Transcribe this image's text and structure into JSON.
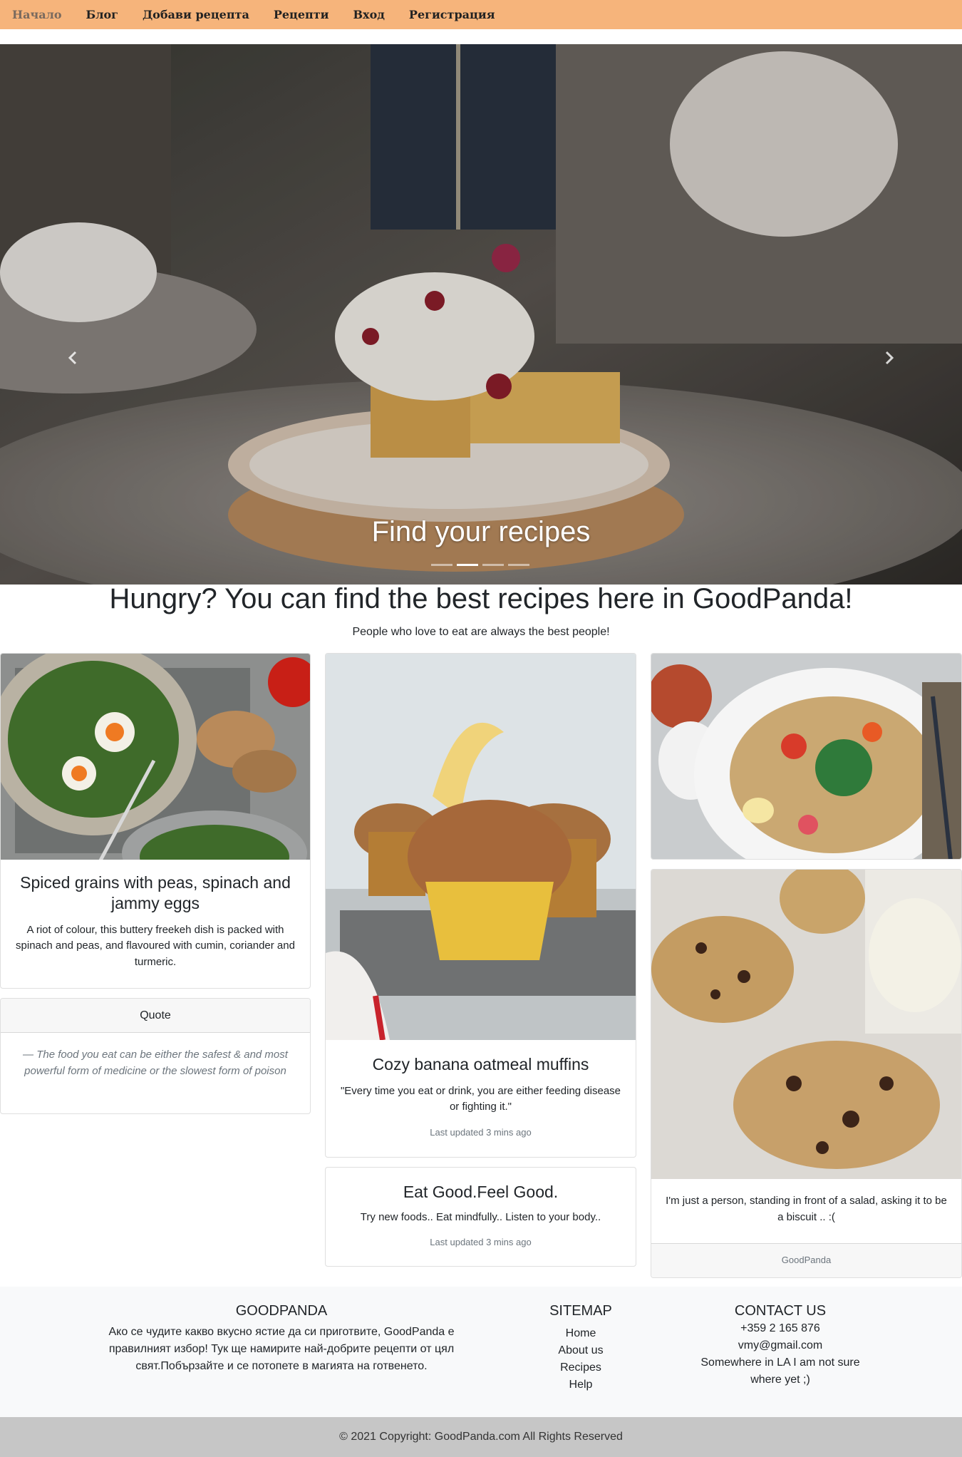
{
  "nav": {
    "items": [
      {
        "label": "Начало",
        "active": true
      },
      {
        "label": "Блог"
      },
      {
        "label": "Добави рецепта"
      },
      {
        "label": "Рецепти"
      },
      {
        "label": "Вход"
      },
      {
        "label": "Регистрация"
      }
    ]
  },
  "hero": {
    "caption": "Find your recipes",
    "active_slide": 2,
    "slide_count": 4
  },
  "intro": {
    "title": "Hungry? You can find the best recipes here in GoodPanda!",
    "subtitle": "People who love to eat are always the best people!"
  },
  "cards": {
    "grains": {
      "title": "Spiced grains with peas, spinach and jammy eggs",
      "text": "A riot of colour, this buttery freekeh dish is packed with spinach and peas, and flavoured with cumin, coriander and turmeric."
    },
    "quote": {
      "header": "Quote",
      "text": "— The food you eat can be either the safest & and most powerful form of medicine or the slowest form of poison"
    },
    "muffins": {
      "title": "Cozy banana oatmeal muffins",
      "text": "\"Every time you eat or drink, you are either feeding disease or fighting it.\"",
      "updated": "Last updated 3 mins ago"
    },
    "eatgood": {
      "title": "Eat Good.Feel Good.",
      "text": "Try new foods.. Eat mindfully.. Listen to your body..",
      "updated": "Last updated 3 mins ago"
    },
    "cookies": {
      "text": "I'm just a person, standing in front of a salad, asking it to be a biscuit .. :(",
      "footer": "GoodPanda"
    }
  },
  "footer": {
    "about": {
      "heading": "GOODPANDA",
      "text": "Ако се чудите какво вкусно ястие да си приготвите, GoodPanda е правилният избор! Тук ще намирите най-добрите рецепти от цял свят.Побързайте и се потопете в магията на готвенето."
    },
    "sitemap": {
      "heading": "SITEMAP",
      "links": [
        "Home",
        "About us",
        "Recipes",
        "Help"
      ]
    },
    "contact": {
      "heading": "CONTACT US",
      "phone": "+359 2 165 876",
      "email": "vmy@gmail.com",
      "address": "Somewhere in LA I am not sure where yet ;)"
    },
    "copyright": "© 2021 Copyright: GoodPanda.com All Rights Reserved"
  },
  "colors": {
    "navbar": "#f6b47b",
    "footer_bg": "#f8f9fa",
    "copyright_bg": "#c6c6c6"
  },
  "icons": [
    "chevron-left-icon",
    "chevron-right-icon"
  ]
}
